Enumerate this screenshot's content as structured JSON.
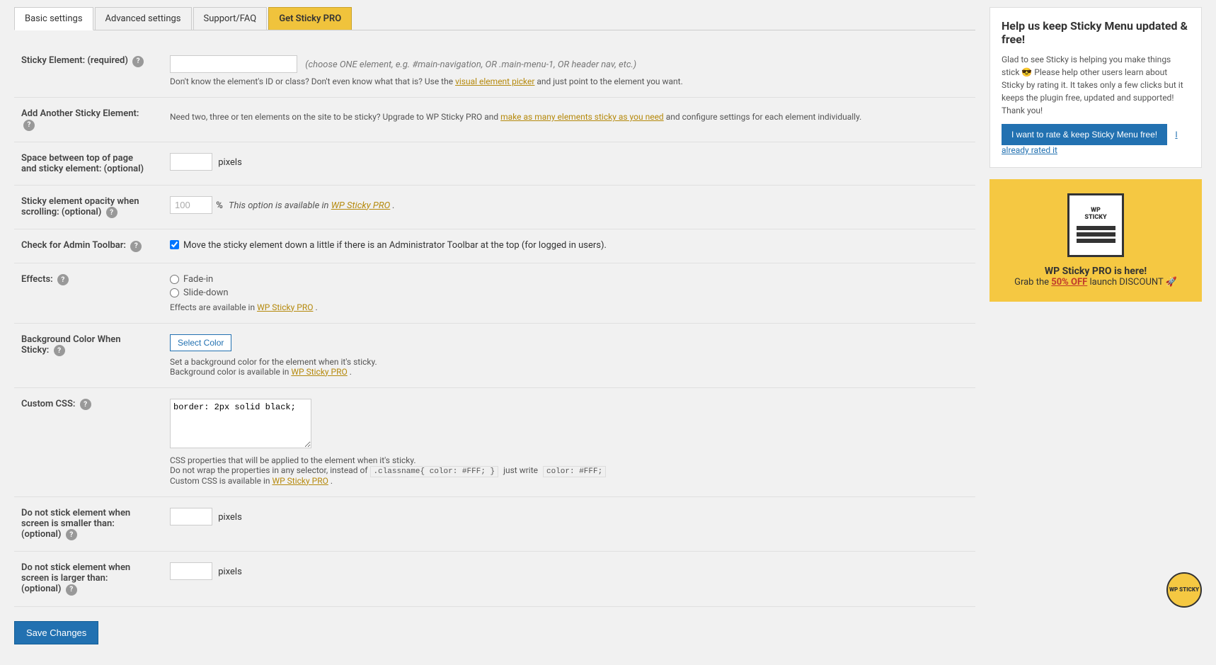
{
  "tabs": [
    {
      "id": "basic",
      "label": "Basic settings",
      "active": true,
      "pro": false
    },
    {
      "id": "advanced",
      "label": "Advanced settings",
      "active": false,
      "pro": false
    },
    {
      "id": "support",
      "label": "Support/FAQ",
      "active": false,
      "pro": false
    },
    {
      "id": "get-pro",
      "label": "Get Sticky PRO",
      "active": false,
      "pro": true
    }
  ],
  "form": {
    "sticky_element": {
      "label": "Sticky Element: (required)",
      "placeholder": "",
      "hint": "(choose ONE element, e.g. #main-navigation, OR .main-menu-1, OR header nav, etc.)",
      "description": "Don't know the element's ID or class? Don't even know what that is? Use the",
      "link_text": "visual element picker",
      "description_end": "and just point to the element you want."
    },
    "add_another": {
      "label": "Add Another Sticky Element:",
      "description_start": "Need two, three or ten elements on the site to be sticky? Upgrade to WP Sticky PRO and",
      "link_text": "make as many elements sticky as you need",
      "description_end": "and configure settings for each element individually."
    },
    "space_top": {
      "label": "Space between top of page and sticky element: (optional)",
      "value": "",
      "unit": "pixels"
    },
    "opacity": {
      "label": "Sticky element opacity when scrolling: (optional)",
      "value": "100",
      "unit": "%",
      "notice": "This option is available in",
      "link_text": "WP Sticky PRO",
      "notice_end": "."
    },
    "admin_toolbar": {
      "label": "Check for Admin Toolbar:",
      "checked": true,
      "description": "Move the sticky element down a little if there is an Administrator Toolbar at the top (for logged in users)."
    },
    "effects": {
      "label": "Effects:",
      "options": [
        "Fade-in",
        "Slide-down"
      ],
      "notice": "Effects are available in",
      "link_text": "WP Sticky PRO",
      "notice_end": "."
    },
    "background_color": {
      "label": "Background Color When Sticky:",
      "button_label": "Select Color",
      "description": "Set a background color for the element when it's sticky.",
      "notice": "Background color is available in",
      "link_text": "WP Sticky PRO",
      "notice_end": "."
    },
    "custom_css": {
      "label": "Custom CSS:",
      "value": "border: 2px solid black;",
      "description1": "CSS properties that will be applied to the element when it's sticky.",
      "description2_start": "Do not wrap the properties in any selector, instead of",
      "code1": ".classname{ color: #FFF; }",
      "description2_mid": "just write",
      "code2": "color: #FFF;",
      "description2_end": "",
      "notice": "Custom CSS is available in",
      "link_text": "WP Sticky PRO",
      "notice_end": "."
    },
    "min_screen": {
      "label": "Do not stick element when screen is smaller than: (optional)",
      "value": "",
      "unit": "pixels"
    },
    "max_screen": {
      "label": "Do not stick element when screen is larger than: (optional)",
      "value": "",
      "unit": "pixels"
    }
  },
  "save_button": "Save Changes",
  "sidebar": {
    "title": "Help us keep Sticky Menu updated & free!",
    "description": "Glad to see Sticky is helping you make things stick 😎 Please help other users learn about Sticky by rating it. It takes only a few clicks but it keeps the plugin free, updated and supported! Thank you!",
    "rate_button": "I want to rate & keep Sticky Menu free!",
    "already_rated": "I already rated it",
    "promo": {
      "title": "WP Sticky PRO is here!",
      "sub_start": "Grab the",
      "link_text": "50% OFF",
      "sub_end": "launch DISCOUNT 🚀"
    }
  },
  "fab_label": "WP STICKY"
}
